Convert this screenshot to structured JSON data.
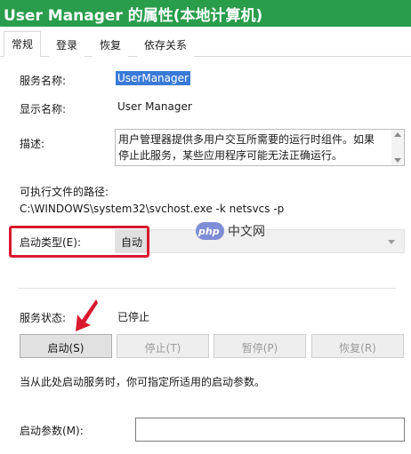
{
  "window": {
    "title": "User Manager 的属性(本地计算机)"
  },
  "tabs": [
    {
      "label": "常规",
      "active": true
    },
    {
      "label": "登录",
      "active": false
    },
    {
      "label": "恢复",
      "active": false
    },
    {
      "label": "依存关系",
      "active": false
    }
  ],
  "general": {
    "service_name_label": "服务名称:",
    "service_name": "UserManager",
    "display_name_label": "显示名称:",
    "display_name": "User Manager",
    "description_label": "描述:",
    "description": "用户管理器提供多用户交互所需要的运行时组件。如果停止此服务，某些应用程序可能无法正确运行。",
    "exe_path_label": "可执行文件的路径:",
    "exe_path": "C:\\WINDOWS\\system32\\svchost.exe -k netsvcs -p",
    "startup_type_label": "启动类型(E):",
    "startup_type": "自动",
    "service_status_label": "服务状态:",
    "service_status": "已停止",
    "buttons": {
      "start": "启动(S)",
      "stop": "停止(T)",
      "pause": "暂停(P)",
      "resume": "恢复(R)"
    },
    "hint": "当从此处启动服务时，你可指定所适用的启动参数。",
    "start_params_label": "启动参数(M):",
    "start_params_value": ""
  },
  "watermark": {
    "logo": "php",
    "text": "中文网"
  },
  "colors": {
    "titlebar": "#2a9d4c",
    "selection": "#3a7ad7",
    "highlight_box": "#d8192f",
    "arrow": "#d8192f"
  }
}
